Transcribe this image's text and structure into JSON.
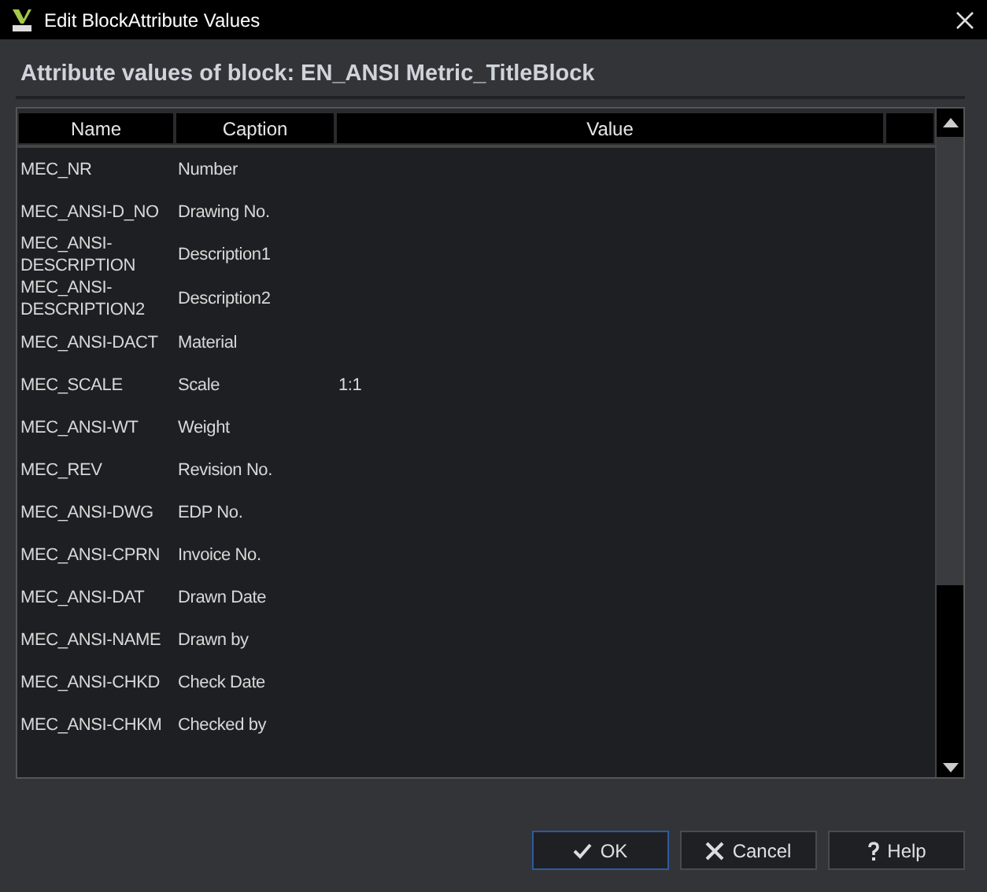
{
  "window": {
    "title": "Edit BlockAttribute Values"
  },
  "heading": "Attribute values of block: EN_ANSI Metric_TitleBlock",
  "table": {
    "columns": [
      "Name",
      "Caption",
      "Value"
    ],
    "rows": [
      {
        "name": "MEC_NR",
        "caption": "Number",
        "value": ""
      },
      {
        "name": "MEC_ANSI-D_NO",
        "caption": "Drawing No.",
        "value": ""
      },
      {
        "name": "MEC_ANSI-DESCRIPTION",
        "caption": "Description1",
        "value": ""
      },
      {
        "name": "MEC_ANSI-DESCRIPTION2",
        "caption": "Description2",
        "value": ""
      },
      {
        "name": "MEC_ANSI-DACT",
        "caption": "Material",
        "value": ""
      },
      {
        "name": "MEC_SCALE",
        "caption": "Scale",
        "value": "1:1"
      },
      {
        "name": "MEC_ANSI-WT",
        "caption": "Weight",
        "value": ""
      },
      {
        "name": "MEC_REV",
        "caption": "Revision No.",
        "value": ""
      },
      {
        "name": "MEC_ANSI-DWG",
        "caption": "EDP No.",
        "value": ""
      },
      {
        "name": "MEC_ANSI-CPRN",
        "caption": "Invoice No.",
        "value": ""
      },
      {
        "name": "MEC_ANSI-DAT",
        "caption": "Drawn Date",
        "value": ""
      },
      {
        "name": "MEC_ANSI-NAME",
        "caption": "Drawn by",
        "value": ""
      },
      {
        "name": "MEC_ANSI-CHKD",
        "caption": "Check Date",
        "value": ""
      },
      {
        "name": "MEC_ANSI-CHKM",
        "caption": "Checked by",
        "value": ""
      }
    ]
  },
  "buttons": [
    {
      "kind": "ok",
      "label": "OK",
      "focused": true
    },
    {
      "kind": "cancel",
      "label": "Cancel",
      "focused": false
    },
    {
      "kind": "help",
      "label": "Help",
      "focused": false
    }
  ]
}
